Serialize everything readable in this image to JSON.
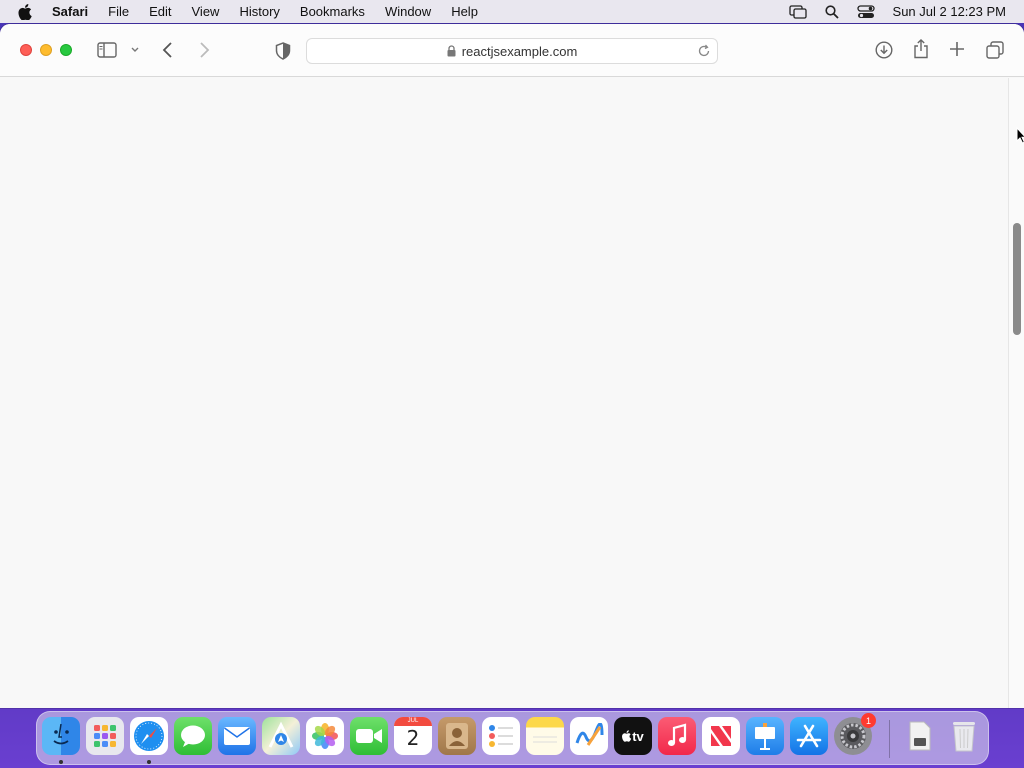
{
  "menubar": {
    "app_name": "Safari",
    "items": [
      "File",
      "Edit",
      "View",
      "History",
      "Bookmarks",
      "Window",
      "Help"
    ],
    "clock": "Sun Jul 2  12:23 PM",
    "icons": [
      "apple-logo-icon",
      "screen-mirroring-icon",
      "spotlight-search-icon",
      "control-center-icon"
    ]
  },
  "browser": {
    "url": "reactjsexample.com",
    "toolbar_icons": [
      "sidebar-toggle-icon",
      "chevron-down-icon",
      "back-icon",
      "forward-icon",
      "privacy-shield-icon",
      "lock-icon",
      "reload-icon",
      "downloads-icon",
      "share-icon",
      "new-tab-icon",
      "tab-overview-icon"
    ]
  },
  "scrollbar": {
    "position": 0.28
  },
  "dock": {
    "calendar": {
      "month": "JUL",
      "day": "2"
    },
    "tv_label": "tv",
    "settings_badge": "1",
    "apps": [
      "Finder",
      "Launchpad",
      "Safari",
      "Messages",
      "Mail",
      "Maps",
      "Photos",
      "FaceTime",
      "Calendar",
      "Contacts",
      "Reminders",
      "Notes",
      "Freeform",
      "TV",
      "Music",
      "News",
      "Keynote",
      "App Store",
      "System Settings",
      "Downloads",
      "Trash"
    ]
  }
}
